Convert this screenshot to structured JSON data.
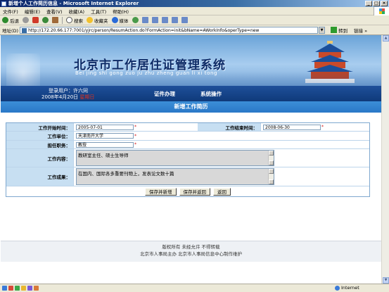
{
  "window": {
    "title": "新增个人工作简历信息 - Microsoft Internet Explorer",
    "controls": [
      "_",
      "□",
      "×"
    ]
  },
  "menu": [
    "文件(F)",
    "编辑(E)",
    "查看(V)",
    "收藏(A)",
    "工具(T)",
    "帮助(H)"
  ],
  "toolbar": {
    "back": "后退",
    "search": "搜索",
    "favorites": "收藏夹",
    "media": "媒体"
  },
  "address": {
    "label": "地址(D)",
    "url": "http://172.20.66.177:7001/yjrc/person/ResumAction.do?FormAction=init&bName=AWorkInfo&operType=new",
    "go": "转到",
    "links": "链接 »"
  },
  "banner": {
    "title": "北京市工作居住证管理系统",
    "pinyin": "Bei jing shi gong zuo ju zhu zheng guan li xi tong"
  },
  "nav": {
    "user_label": "登录用户：许六同",
    "date": "2008年4月20日",
    "weekday": "星期日",
    "item1": "证件办理",
    "item2": "系统操作"
  },
  "page_title": "新增工作简历",
  "form": {
    "start_label": "工作开始时间：",
    "start_value": "2005-07-01",
    "end_label": "工作结束时间：",
    "end_value": "2008-06-30",
    "org_label": "工作单位：",
    "org_value": "天津南开大学",
    "position_label": "担任职务：",
    "position_value": "教授",
    "content_label": "工作内容：",
    "content_value": "教研室主任、硕士生导师",
    "result_label": "工作成果：",
    "result_value": "在国内、国际各多重要刊物上，发表论文数十篇",
    "required_mark": "*"
  },
  "buttons": {
    "save_new": "保存并新增",
    "save_back": "保存并返回",
    "back": "返回"
  },
  "footer": {
    "line1": "版权所有 未经允许 不得转载",
    "line2": "北京市人事局主办 北京市人事局信息中心制作维护"
  },
  "status": {
    "zone": "Internet"
  }
}
